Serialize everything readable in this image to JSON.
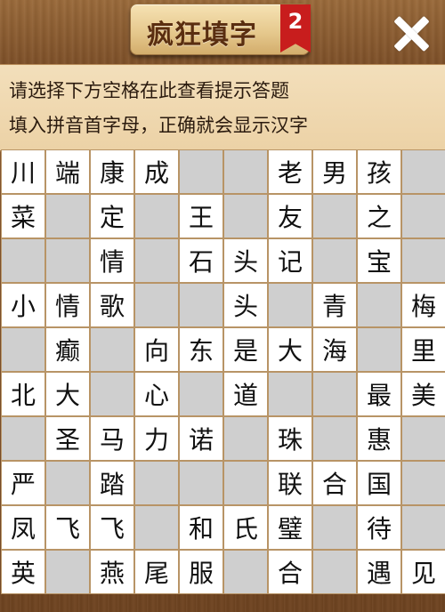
{
  "header": {
    "title": "疯狂填字",
    "level": "2"
  },
  "hint": {
    "line1": "请选择下方空格在此查看提示答题",
    "line2": "填入拼音首字母，正确就会显示汉字"
  },
  "grid": [
    [
      "川",
      "端",
      "康",
      "成",
      "",
      "",
      "老",
      "男",
      "孩",
      ""
    ],
    [
      "菜",
      "",
      "定",
      "",
      "王",
      "",
      "友",
      "",
      "之",
      ""
    ],
    [
      "",
      "",
      "情",
      "",
      "石",
      "头",
      "记",
      "",
      "宝",
      ""
    ],
    [
      "小",
      "情",
      "歌",
      "",
      "",
      "头",
      "",
      "青",
      "",
      "梅"
    ],
    [
      "",
      "癫",
      "",
      "向",
      "东",
      "是",
      "大",
      "海",
      "",
      "里"
    ],
    [
      "北",
      "大",
      "",
      "心",
      "",
      "道",
      "",
      "",
      "最",
      "美"
    ],
    [
      "",
      "圣",
      "马",
      "力",
      "诺",
      "",
      "珠",
      "",
      "惠",
      ""
    ],
    [
      "严",
      "",
      "踏",
      "",
      "",
      "",
      "联",
      "合",
      "国",
      ""
    ],
    [
      "凤",
      "飞",
      "飞",
      "",
      "和",
      "氏",
      "璧",
      "",
      "待",
      ""
    ],
    [
      "英",
      "",
      "燕",
      "尾",
      "服",
      "",
      "合",
      "",
      "遇",
      "见"
    ]
  ],
  "colors": {
    "filled_cell": "#ffffff",
    "empty_cell": "#cfcfcf",
    "badge": "#c81d1d"
  },
  "icons": {
    "close": "close-icon"
  }
}
